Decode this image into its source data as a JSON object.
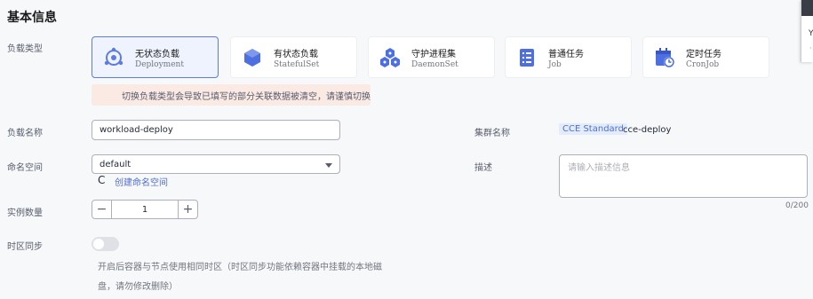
{
  "section_title": "基本信息",
  "workload_type": {
    "label": "负载类型",
    "cards": [
      {
        "title": "无状态负载",
        "subtitle": "Deployment",
        "icon": "deployment-icon",
        "selected": true
      },
      {
        "title": "有状态负载",
        "subtitle": "StatefulSet",
        "icon": "statefulset-icon",
        "selected": false
      },
      {
        "title": "守护进程集",
        "subtitle": "DaemonSet",
        "icon": "daemonset-icon",
        "selected": false
      },
      {
        "title": "普通任务",
        "subtitle": "Job",
        "icon": "job-icon",
        "selected": false
      },
      {
        "title": "定时任务",
        "subtitle": "CronJob",
        "icon": "cronjob-icon",
        "selected": false
      }
    ],
    "warning": "切换负载类型会导致已填写的部分关联数据被清空，请谨慎切换",
    "warning_icon": ""
  },
  "workload_name": {
    "label": "负载名称",
    "value": "workload-deploy"
  },
  "namespace": {
    "label": "命名空间",
    "value": "default",
    "create_link": "创建命名空间",
    "refresh_icon": "C"
  },
  "instances": {
    "label": "实例数量",
    "value": "1",
    "minus": "−",
    "plus": "+"
  },
  "timezone_sync": {
    "label": "时区同步",
    "enabled": false,
    "hint_line1": "开启后容器与节点使用相同时区（时区同步功能依赖容器中挂载的本地磁",
    "hint_line2": "盘，请勿修改删除）"
  },
  "cluster": {
    "label": "集群名称",
    "tag": "CCE Standard",
    "name": "cce-deploy"
  },
  "description": {
    "label": "描述",
    "placeholder": "请输入描述信息",
    "counter": "0/200"
  },
  "tooltip": {
    "text": "Y",
    "subtext": "·"
  },
  "colors": {
    "accent": "#5e7ce0",
    "link": "#526ecc",
    "warning_bg": "#fbe9e4",
    "warning_icon": "#c7000b"
  }
}
